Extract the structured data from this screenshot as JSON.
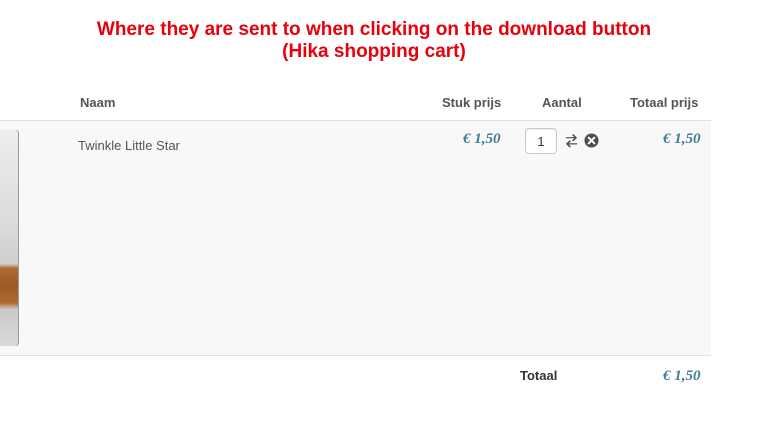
{
  "annotation": {
    "line1": "Where they are sent to when clicking on the download button",
    "line2": "(Hika shopping cart)"
  },
  "colors": {
    "annotation": "#e8000b",
    "price": "#3b7c96",
    "row_background": "#f8f8f8"
  },
  "cart": {
    "columns": {
      "name": "Naam",
      "unit_price": "Stuk prijs",
      "quantity": "Aantal",
      "total_price": "Totaal prijs"
    },
    "items": [
      {
        "name": "Twinkle Little Star",
        "unit_price": "€ 1,50",
        "quantity": "1",
        "total_price": "€ 1,50",
        "icons": [
          "refresh-icon",
          "remove-icon"
        ]
      }
    ],
    "total_label": "Totaal",
    "total_value": "€ 1,50"
  }
}
